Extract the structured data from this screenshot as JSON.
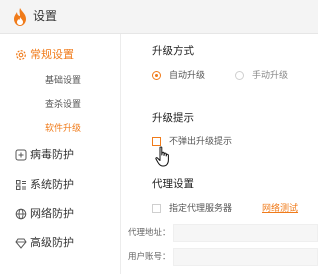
{
  "window": {
    "title": "设置",
    "logo_icon": "flame-icon"
  },
  "colors": {
    "accent": "#f07b1a"
  },
  "sidebar": {
    "items": [
      {
        "label": "常规设置",
        "icon": "gear-icon",
        "active": true
      },
      {
        "label": "基础设置",
        "sub": true
      },
      {
        "label": "查杀设置",
        "sub": true
      },
      {
        "label": "软件升级",
        "sub": true,
        "active": true
      },
      {
        "label": "病毒防护",
        "icon": "plus-square-icon"
      },
      {
        "label": "系统防护",
        "icon": "system-icon"
      },
      {
        "label": "网络防护",
        "icon": "globe-icon"
      },
      {
        "label": "高级防护",
        "icon": "diamond-icon"
      }
    ]
  },
  "main": {
    "upgrade_method": {
      "title": "升级方式",
      "options": [
        {
          "label": "自动升级",
          "selected": true
        },
        {
          "label": "手动升级",
          "selected": false
        }
      ]
    },
    "upgrade_notice": {
      "title": "升级提示",
      "checkbox_label": "不弹出升级提示",
      "checked": false
    },
    "proxy": {
      "title": "代理设置",
      "checkbox_label": "指定代理服务器",
      "checked": false,
      "test_link": "网络测试",
      "address_label": "代理地址：",
      "account_label": "用户账号："
    }
  }
}
